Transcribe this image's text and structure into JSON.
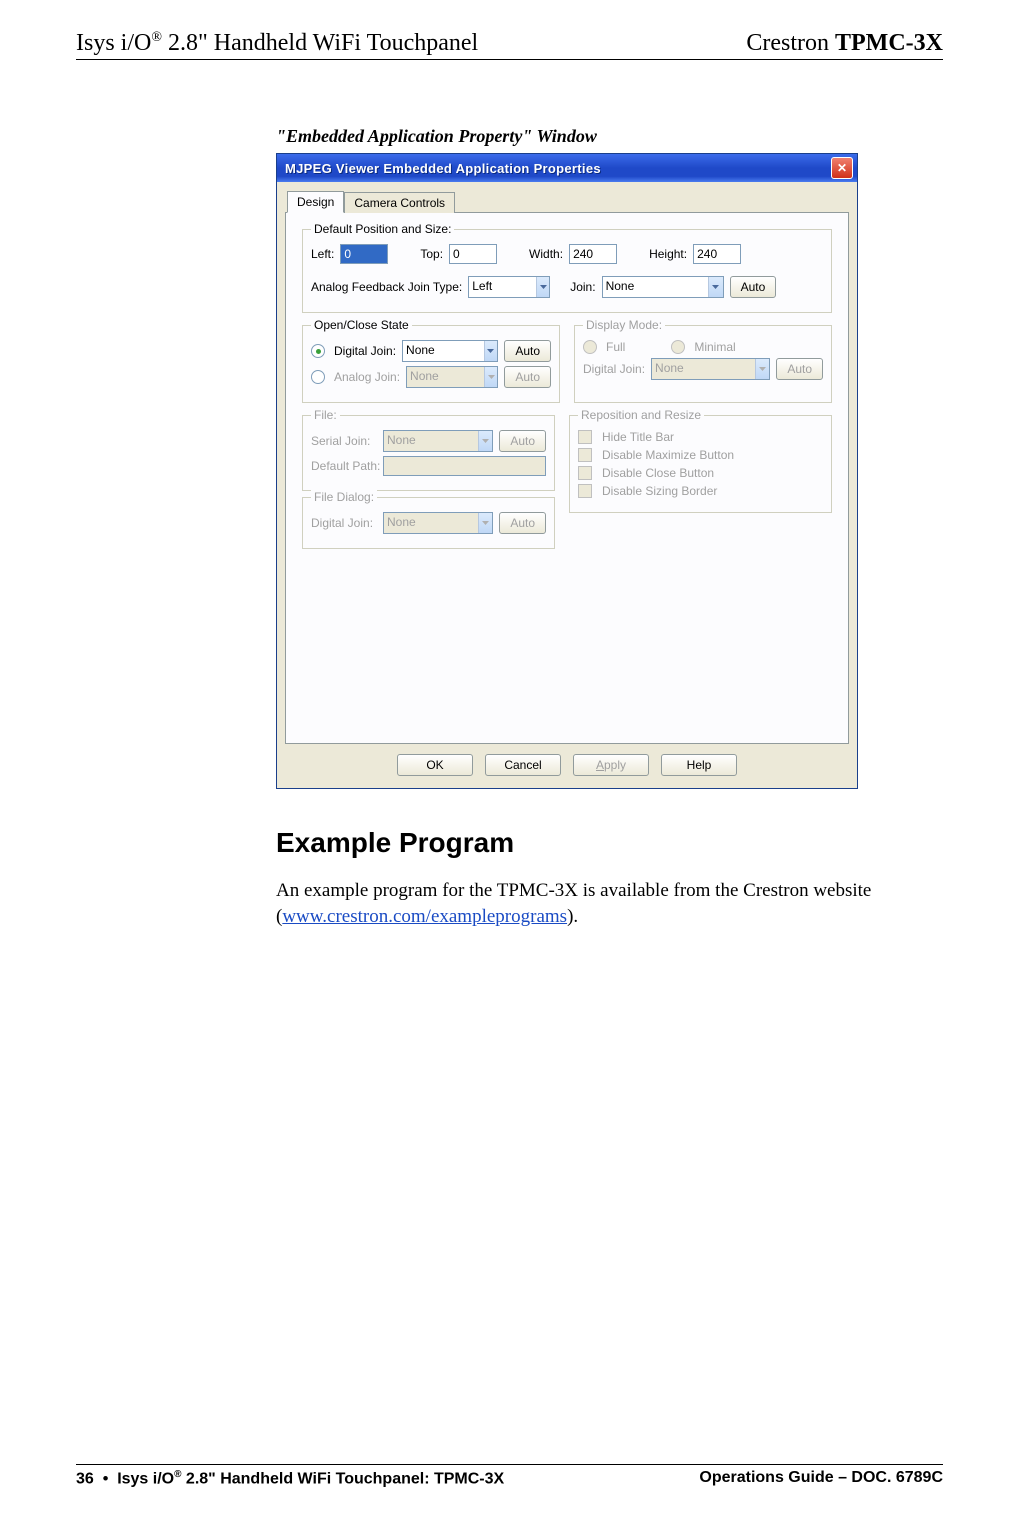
{
  "header": {
    "left_prefix": "Isys i/O",
    "left_sup": "®",
    "left_suffix": " 2.8\" Handheld WiFi Touchpanel",
    "right_prefix": "Crestron ",
    "right_bold": "TPMC-3X"
  },
  "caption": "\"Embedded Application Property\" Window",
  "window": {
    "title": "MJPEG Viewer Embedded Application Properties",
    "tabs": {
      "design": "Design",
      "camera": "Camera Controls"
    },
    "group_pos": {
      "legend": "Default Position and Size:",
      "left_label": "Left:",
      "left_val": "0",
      "top_label": "Top:",
      "top_val": "0",
      "width_label": "Width:",
      "width_val": "240",
      "height_label": "Height:",
      "height_val": "240",
      "afjt_label": "Analog Feedback Join Type:",
      "afjt_val": "Left",
      "join_label": "Join:",
      "join_val": "None",
      "auto": "Auto"
    },
    "group_open": {
      "legend": "Open/Close State",
      "digital_label": "Digital Join:",
      "digital_val": "None",
      "analog_label": "Analog Join:",
      "analog_val": "None",
      "auto": "Auto"
    },
    "group_display": {
      "legend": "Display Mode:",
      "full": "Full",
      "minimal": "Minimal",
      "digital_label": "Digital Join:",
      "digital_val": "None",
      "auto": "Auto"
    },
    "group_file": {
      "legend": "File:",
      "serial_label": "Serial Join:",
      "serial_val": "None",
      "default_path": "Default Path:",
      "auto": "Auto"
    },
    "group_resize": {
      "legend": "Reposition and Resize",
      "hide": "Hide Title Bar",
      "dismax": "Disable Maximize Button",
      "disclose": "Disable Close Button",
      "dissize": "Disable Sizing Border"
    },
    "group_filedlg": {
      "legend": "File Dialog:",
      "digital_label": "Digital Join:",
      "digital_val": "None",
      "auto": "Auto"
    },
    "buttons": {
      "ok": "OK",
      "cancel": "Cancel",
      "apply": "Apply",
      "help": "Help"
    }
  },
  "section_title": "Example Program",
  "body_pre": "An example program for the TPMC-3X is available from the Crestron website (",
  "body_link": "www.crestron.com/exampleprograms",
  "body_post": ").",
  "footer": {
    "page": "36",
    "bullet": "•",
    "left_prefix": "Isys i/O",
    "left_sup": "®",
    "left_suffix": " 2.8\" Handheld WiFi Touchpanel: TPMC-3X",
    "right": "Operations Guide – DOC. 6789C"
  }
}
